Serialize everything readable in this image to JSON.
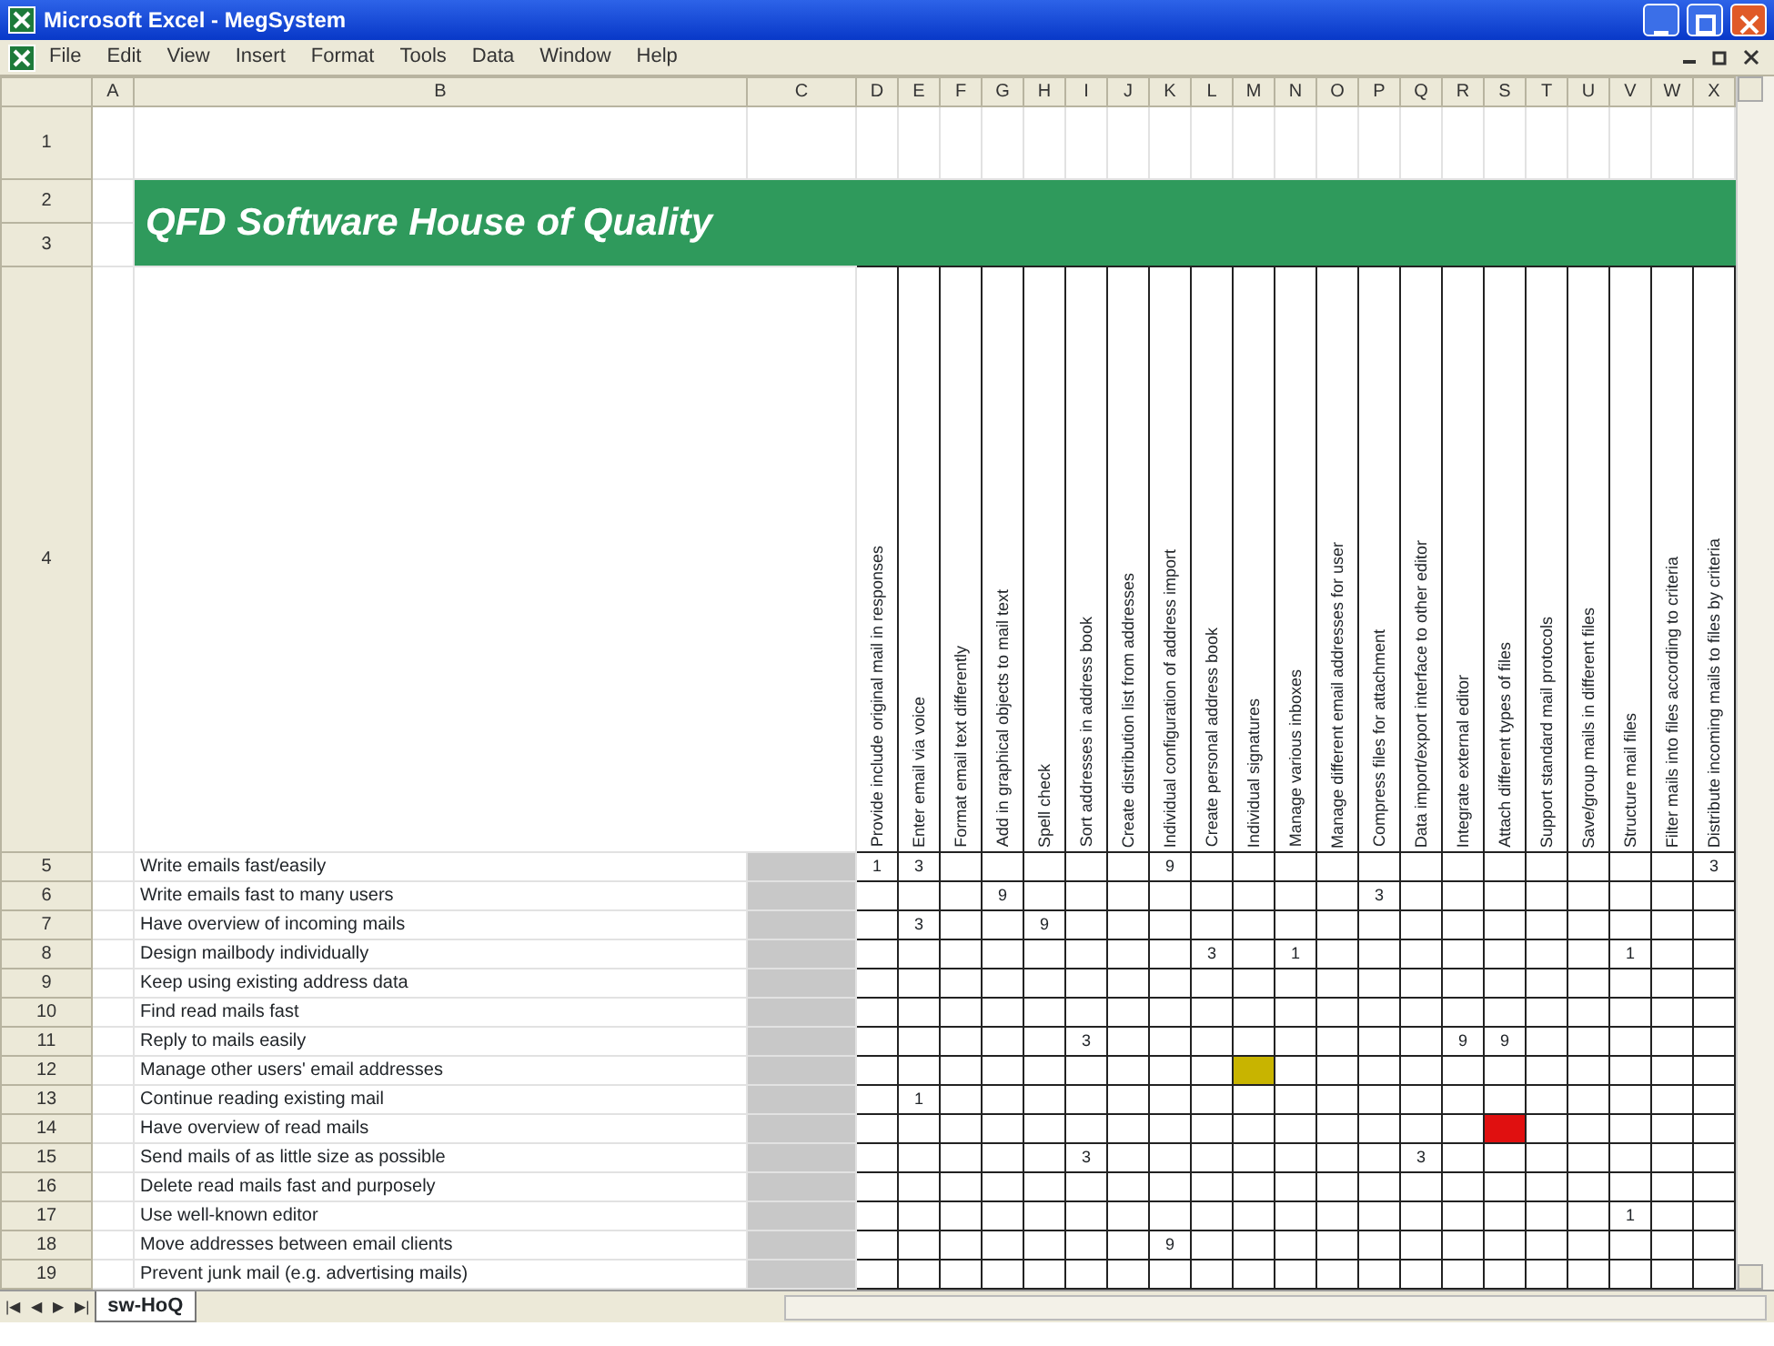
{
  "window": {
    "title": "Microsoft Excel - MegSystem"
  },
  "menu": [
    "File",
    "Edit",
    "View",
    "Insert",
    "Format",
    "Tools",
    "Data",
    "Window",
    "Help"
  ],
  "column_headers": [
    "A",
    "B",
    "C",
    "D",
    "E",
    "F",
    "G",
    "H",
    "I",
    "J",
    "K",
    "L",
    "M",
    "N",
    "O",
    "P",
    "Q",
    "R",
    "S",
    "T",
    "U",
    "V",
    "W",
    "X"
  ],
  "row_headers": [
    "1",
    "2",
    "3",
    "4",
    "5",
    "6",
    "7",
    "8",
    "9",
    "10",
    "11",
    "12",
    "13",
    "14",
    "15",
    "16",
    "17",
    "18",
    "19"
  ],
  "sheet_title": "QFD Software House of Quality",
  "technical_requirements": [
    "Provide include original mail in responses",
    "Enter email via voice",
    "Format email text differently",
    "Add in graphical objects to mail text",
    "Spell check",
    "Sort addresses in address book",
    "Create distribution list from addresses",
    "Individual configuration of address import",
    "Create personal address book",
    "Individual signatures",
    "Manage various inboxes",
    "Manage different email addresses for user",
    "Compress files for attachment",
    "Data import/export interface to other editor",
    "Integrate external editor",
    "Attach different types of files",
    "Support standard mail protocols",
    "Save/group mails in different files",
    "Structure mail files",
    "Filter mails into files according to criteria",
    "Distribute incoming mails to files by criteria"
  ],
  "customer_requirements": [
    {
      "requirement": "Write emails fast/easily",
      "cells": [
        {
          "value": "1"
        },
        {
          "value": "3"
        },
        {},
        {},
        {},
        {},
        {},
        {
          "value": "9"
        },
        {},
        {},
        {},
        {},
        {},
        {},
        {},
        {},
        {},
        {},
        {},
        {},
        {
          "value": "3"
        }
      ]
    },
    {
      "requirement": "Write emails fast to many users",
      "cells": [
        {},
        {},
        {},
        {
          "value": "9"
        },
        {},
        {},
        {},
        {},
        {},
        {},
        {},
        {},
        {
          "value": "3"
        },
        {},
        {},
        {},
        {},
        {},
        {},
        {},
        {}
      ]
    },
    {
      "requirement": "Have overview of incoming mails",
      "cells": [
        {},
        {
          "value": "3"
        },
        {},
        {},
        {
          "value": "9"
        },
        {},
        {},
        {},
        {},
        {},
        {},
        {},
        {},
        {},
        {},
        {},
        {},
        {},
        {},
        {},
        {}
      ]
    },
    {
      "requirement": "Design mailbody individually",
      "cells": [
        {},
        {},
        {},
        {},
        {},
        {},
        {},
        {},
        {
          "value": "3"
        },
        {},
        {
          "value": "1"
        },
        {},
        {},
        {},
        {},
        {},
        {},
        {},
        {
          "value": "1"
        },
        {},
        {}
      ]
    },
    {
      "requirement": "Keep using existing address data",
      "cells": [
        {},
        {},
        {},
        {},
        {},
        {},
        {},
        {},
        {},
        {},
        {},
        {},
        {},
        {},
        {},
        {},
        {},
        {},
        {},
        {},
        {}
      ]
    },
    {
      "requirement": "Find read mails fast",
      "cells": [
        {},
        {},
        {},
        {},
        {},
        {},
        {},
        {},
        {},
        {},
        {},
        {},
        {},
        {},
        {},
        {},
        {},
        {},
        {},
        {},
        {}
      ]
    },
    {
      "requirement": "Reply to mails easily",
      "cells": [
        {},
        {},
        {},
        {},
        {},
        {
          "value": "3"
        },
        {},
        {},
        {},
        {},
        {},
        {},
        {},
        {},
        {
          "value": "9"
        },
        {
          "value": "9"
        },
        {},
        {},
        {},
        {},
        {}
      ]
    },
    {
      "requirement": "Manage other users' email addresses",
      "cells": [
        {},
        {},
        {},
        {},
        {},
        {},
        {},
        {},
        {},
        {
          "color": "#c8b400"
        },
        {},
        {},
        {},
        {},
        {},
        {},
        {},
        {},
        {},
        {},
        {}
      ]
    },
    {
      "requirement": "Continue reading existing mail",
      "cells": [
        {},
        {
          "value": "1"
        },
        {},
        {},
        {},
        {},
        {},
        {},
        {},
        {},
        {},
        {},
        {},
        {},
        {},
        {},
        {},
        {},
        {},
        {},
        {}
      ]
    },
    {
      "requirement": "Have overview of read mails",
      "cells": [
        {},
        {},
        {},
        {},
        {},
        {},
        {},
        {},
        {},
        {},
        {},
        {},
        {},
        {},
        {},
        {
          "color": "#e01010"
        },
        {},
        {},
        {},
        {},
        {}
      ]
    },
    {
      "requirement": "Send mails of as little size as possible",
      "cells": [
        {},
        {},
        {},
        {},
        {},
        {
          "value": "3"
        },
        {},
        {},
        {},
        {},
        {},
        {},
        {},
        {
          "value": "3"
        },
        {},
        {},
        {},
        {},
        {},
        {},
        {}
      ]
    },
    {
      "requirement": "Delete read mails fast and purposely",
      "cells": [
        {},
        {},
        {},
        {},
        {},
        {},
        {},
        {},
        {},
        {},
        {},
        {},
        {},
        {},
        {},
        {},
        {},
        {},
        {},
        {},
        {}
      ]
    },
    {
      "requirement": "Use well-known editor",
      "cells": [
        {},
        {},
        {},
        {},
        {},
        {},
        {},
        {},
        {},
        {},
        {},
        {},
        {},
        {},
        {},
        {},
        {},
        {},
        {
          "value": "1"
        },
        {},
        {}
      ]
    },
    {
      "requirement": "Move addresses between email clients",
      "cells": [
        {},
        {},
        {},
        {},
        {},
        {},
        {},
        {
          "value": "9"
        },
        {},
        {},
        {},
        {},
        {},
        {},
        {},
        {},
        {},
        {},
        {},
        {},
        {}
      ]
    },
    {
      "requirement": "Prevent junk mail (e.g. advertising mails)",
      "cells": [
        {},
        {},
        {},
        {},
        {},
        {},
        {},
        {},
        {},
        {},
        {},
        {},
        {},
        {},
        {},
        {},
        {},
        {},
        {},
        {},
        {}
      ]
    }
  ],
  "sheet_nav": [
    "|◀",
    "◀",
    "▶",
    "▶|"
  ],
  "sheet_tabs": [
    {
      "label": "sw-HoQ",
      "selected": true
    }
  ]
}
